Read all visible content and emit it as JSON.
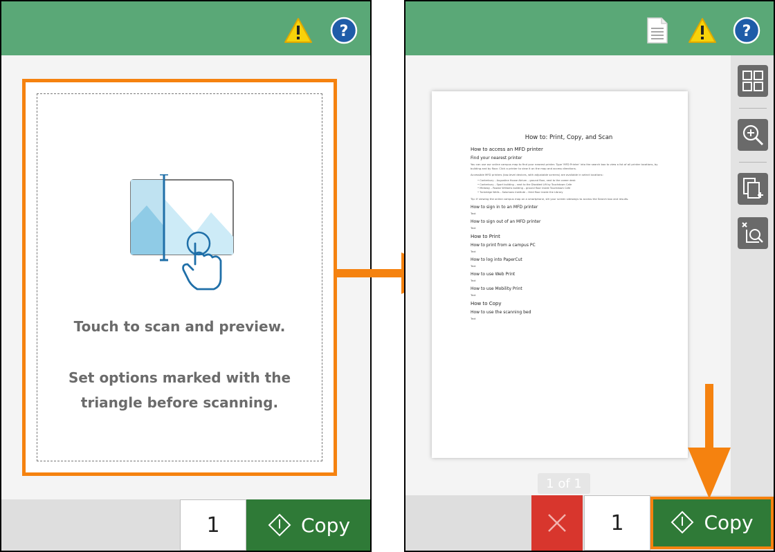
{
  "left_panel": {
    "hint_line1": "Touch to scan and preview.",
    "hint_line2a": "Set options marked with the",
    "hint_line2b": "triangle before scanning.",
    "quantity": "1",
    "copy_label": "Copy"
  },
  "right_panel": {
    "preview": {
      "title": "How to: Print, Copy, and Scan",
      "sections": [
        {
          "heading": "How to access an MFD printer",
          "big": true
        },
        {
          "heading": "Find your nearest printer"
        },
        {
          "text": "You can use our online campus map to find your nearest printer. Type 'MFD Printer' into the search box to view a list of all printer locations, by building and by floor. Click a printer to view it on the map and access directions."
        },
        {
          "text": "Accessible MFD printers (low-level devices, with adjustable screens) are available in select locations:"
        }
      ],
      "list_items": [
        "Canterbury – Augustine House Atrium – ground floor, next to the career desk",
        "Canterbury – Sport building – next to the Disabled Lift by Touchdown Cafe",
        "Medway – Rowan Williams building – ground floor inside Touchdown Cafe",
        "Tunbridge Wells – Salomons Institute – third floor inside the Library"
      ],
      "tip": "Tip: If viewing the online campus map on a smartphone, slit your screen sideways to access the Search box and results.",
      "subsections": [
        {
          "heading": "How to sign in to an MFD printer",
          "text": "Text"
        },
        {
          "heading": "How to sign out of an MFD printer",
          "text": "Text"
        },
        {
          "heading": "How to Print",
          "big": true
        },
        {
          "heading": "How to print from a campus PC",
          "text": "Text"
        },
        {
          "heading": "How to log into PaperCut",
          "text": "Text"
        },
        {
          "heading": "How to use Web Print",
          "text": "Text"
        },
        {
          "heading": "How to use Mobility Print",
          "text": "Text"
        },
        {
          "heading": "How to Copy",
          "big": true
        },
        {
          "heading": "How to use the scanning bed",
          "text": "Text"
        }
      ]
    },
    "page_indicator": "1 of 1",
    "quantity": "1",
    "copy_label": "Copy"
  },
  "colors": {
    "header_green": "#5aa877",
    "copy_green": "#2f7a37",
    "cancel_red": "#d8362d",
    "highlight_orange": "#f5820f",
    "warning_yellow": "#f7d20a",
    "help_blue": "#1f5ca8"
  },
  "icons": [
    "warning-icon",
    "help-icon",
    "document-icon",
    "grid-view-icon",
    "zoom-in-icon",
    "add-page-icon",
    "remove-page-icon",
    "start-diamond-icon",
    "cancel-x-icon"
  ]
}
